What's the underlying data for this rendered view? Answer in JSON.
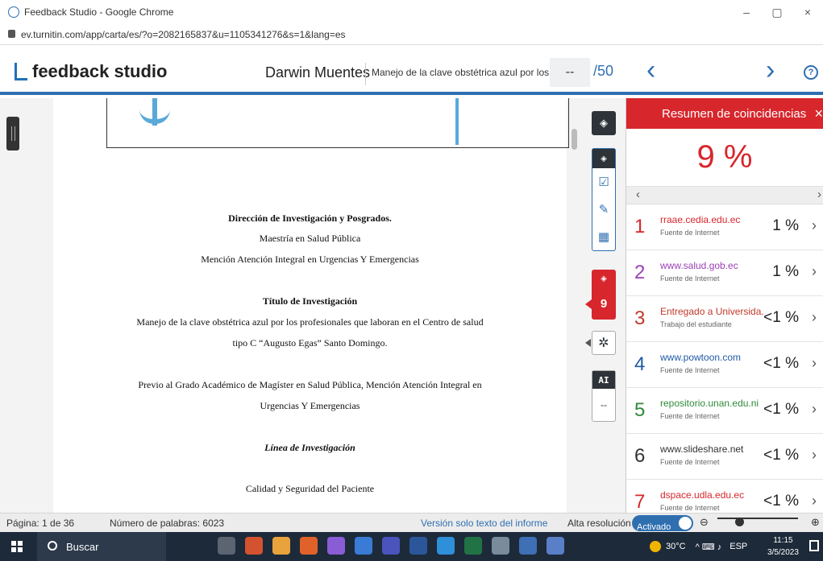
{
  "browser": {
    "window_title": "Feedback Studio - Google Chrome",
    "url": "ev.turnitin.com/app/carta/es/?o=2082165837&u=1105341276&s=1&lang=es",
    "minimize": "–",
    "maximize": "▢",
    "close": "×"
  },
  "header": {
    "logo": "feedback studio",
    "student": "Darwin Muentes",
    "doc_title": "Manejo de la clave obstétrica azul por los pr...",
    "grade": "--",
    "grade_of": "/50",
    "prev": "‹",
    "next": "›",
    "help": "?"
  },
  "document": {
    "lines": [
      "Dirección de Investigación y Posgrados.",
      "Maestría en Salud Pública",
      "Mención Atención Integral en Urgencias Y Emergencias",
      "Título de Investigación",
      "Manejo de la clave obstétrica azul por los profesionales que laboran en el Centro de salud",
      "tipo C “Augusto Egas” Santo Domingo.",
      "Previo al Grado Académico de Magíster en Salud Pública, Mención Atención Integral en",
      "Urgencias Y Emergencias",
      "Línea de Investigación",
      "Calidad y Seguridad del Paciente"
    ]
  },
  "tools": {
    "similarity_count": "9",
    "ai_label": "AI",
    "ai_value": "--"
  },
  "panel": {
    "title": "Resumen de coincidencias",
    "close": "×",
    "overall": "9 %",
    "pager_prev": "‹",
    "pager_next": "›",
    "matches": [
      {
        "rank": "1",
        "source": "rraae.cedia.edu.ec",
        "type": "Fuente de Internet",
        "percent": "1 %",
        "color": "#d7262c"
      },
      {
        "rank": "2",
        "source": "www.salud.gob.ec",
        "type": "Fuente de Internet",
        "percent": "1 %",
        "color": "#9b3fb5"
      },
      {
        "rank": "3",
        "source": "Entregado a Universida...",
        "type": "Trabajo del estudiante",
        "percent": "<1 %",
        "color": "#c0392b"
      },
      {
        "rank": "4",
        "source": "www.powtoon.com",
        "type": "Fuente de Internet",
        "percent": "<1 %",
        "color": "#1f5aa6"
      },
      {
        "rank": "5",
        "source": "repositorio.unan.edu.ni",
        "type": "Fuente de Internet",
        "percent": "<1 %",
        "color": "#2e8b3a"
      },
      {
        "rank": "6",
        "source": "www.slideshare.net",
        "type": "Fuente de Internet",
        "percent": "<1 %",
        "color": "#333333"
      },
      {
        "rank": "7",
        "source": "dspace.udla.edu.ec",
        "type": "Fuente de Internet",
        "percent": "<1 %",
        "color": "#d7262c"
      }
    ]
  },
  "status": {
    "page": "Página: 1 de 36",
    "words": "Número de palabras: 6023",
    "text_only": "Versión solo texto del informe",
    "hires_label": "Alta resolución",
    "hires_state": "Activado"
  },
  "taskbar": {
    "search": "Buscar",
    "temp": "30°C",
    "lang": "ESP",
    "time": "11:15",
    "date": "3/5/2023"
  }
}
